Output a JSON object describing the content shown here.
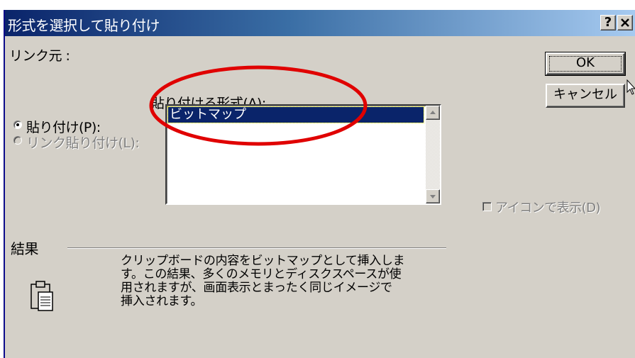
{
  "dialog": {
    "title": "形式を選択して貼り付け",
    "help_button": "?",
    "close_button": "✕"
  },
  "source": {
    "label": "リンク元 :"
  },
  "paste_options": {
    "paste_label": "貼り付け(P):",
    "paste_link_label": "リンク貼り付け(L):",
    "selected": "paste"
  },
  "format_list": {
    "label": "貼り付ける形式(A):",
    "items": [
      "ビットマップ"
    ],
    "selected_index": 0
  },
  "buttons": {
    "ok": "OK",
    "cancel": "キャンセル"
  },
  "display_as_icon": {
    "label": "アイコンで表示(D)",
    "checked": false,
    "enabled": false
  },
  "result": {
    "heading": "結果",
    "text": "クリップボードの内容をビットマップとして挿入しま\nす。この結果、多くのメモリとディスクスペースが使\n用されますが、画面表示とまったく同じイメージで\n挿入されます。"
  },
  "annotation": {
    "color": "#e00000"
  },
  "colors": {
    "title_start": "#0a246a",
    "title_end": "#a6caf0",
    "selection": "#0a246a",
    "face": "#d4d0c8"
  }
}
